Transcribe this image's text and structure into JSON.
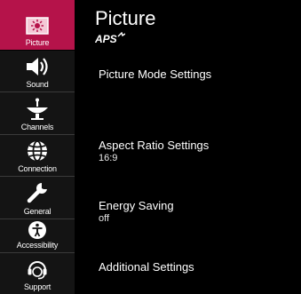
{
  "sidebar": {
    "items": [
      {
        "label": "Picture",
        "icon": "picture-icon"
      },
      {
        "label": "Sound",
        "icon": "speaker-icon"
      },
      {
        "label": "Channels",
        "icon": "satellite-dish-icon"
      },
      {
        "label": "Connection",
        "icon": "globe-icon"
      },
      {
        "label": "General",
        "icon": "wrench-icon"
      },
      {
        "label": "Accessibility",
        "icon": "accessibility-icon"
      },
      {
        "label": "Support",
        "icon": "headset-icon"
      }
    ],
    "active_index": 0
  },
  "header": {
    "title": "Picture",
    "logo_text": "APS"
  },
  "settings": [
    {
      "name": "Picture Mode Settings",
      "value": ""
    },
    {
      "name": "Aspect Ratio Settings",
      "value": "16:9"
    },
    {
      "name": "Energy Saving",
      "value": "off"
    },
    {
      "name": "Additional Settings",
      "value": ""
    }
  ],
  "colors": {
    "active_tab": "#b5134a",
    "sidebar_bg": "#141414",
    "background": "#000000"
  }
}
